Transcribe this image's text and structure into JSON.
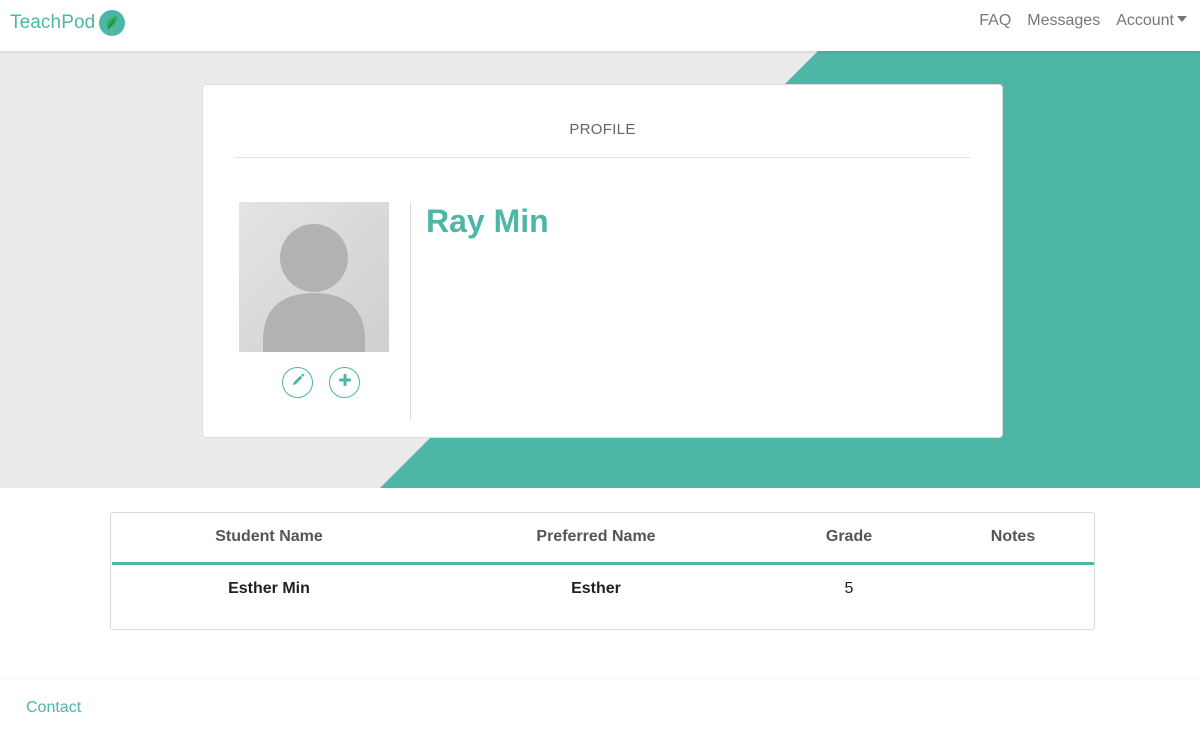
{
  "navbar": {
    "brand": "TeachPod",
    "links": [
      "FAQ",
      "Messages",
      "Account"
    ]
  },
  "profile": {
    "card_title": "PROFILE",
    "name": "Ray Min"
  },
  "students_table": {
    "headers": [
      "Student Name",
      "Preferred Name",
      "Grade",
      "Notes"
    ],
    "rows": [
      [
        "Esther Min",
        "Esther",
        "5",
        ""
      ]
    ]
  },
  "footer": {
    "contact_label": "Contact"
  },
  "colors": {
    "accent": "#4db6a6",
    "hero_bg": "#ebebeb"
  },
  "icons": [
    "leaf-icon",
    "pencil-icon",
    "plus-icon",
    "avatar-placeholder-icon"
  ]
}
